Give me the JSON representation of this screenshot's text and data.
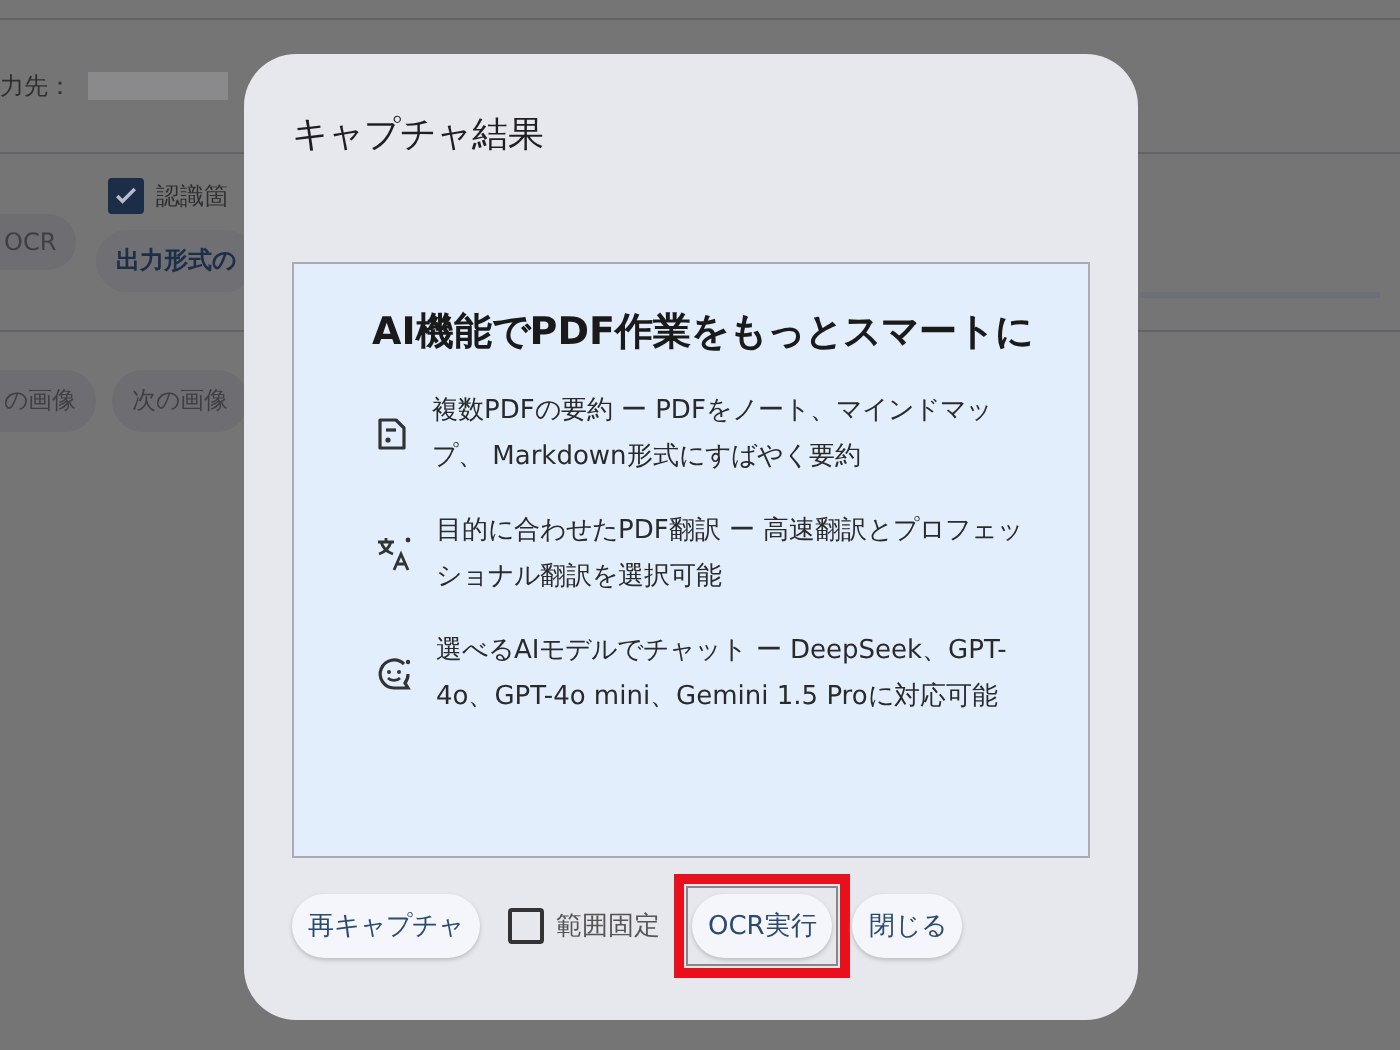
{
  "background": {
    "output_label": "力先：",
    "ocr_button": "OCR",
    "recognize_checkbox": {
      "label": "認識箇",
      "checked": true
    },
    "format_button": "出力形式の",
    "prev_button": "の画像",
    "next_button": "次の画像"
  },
  "dialog": {
    "title": "キャプチャ結果",
    "preview": {
      "heading": "AI機能でPDF作業をもっとスマートに",
      "features": [
        {
          "text": "複数PDFの要約 ー PDFをノート、マインドマップ、 Markdown形式にすばやく要約"
        },
        {
          "text": "目的に合わせたPDF翻訳 ー 高速翻訳とプロフェッショナル翻訳を選択可能"
        },
        {
          "text": "選べるAIモデルでチャット ー DeepSeek、GPT-4o、GPT-4o mini、Gemini 1.5 Proに対応可能"
        }
      ]
    },
    "actions": [
      {
        "kind": "button",
        "label": "再キャプチャ",
        "highlighted": false
      },
      {
        "kind": "checkbox",
        "label": "範囲固定",
        "checked": false
      },
      {
        "kind": "button",
        "label": "OCR実行",
        "highlighted": true
      },
      {
        "kind": "button",
        "label": "閉じる",
        "highlighted": false
      }
    ]
  }
}
